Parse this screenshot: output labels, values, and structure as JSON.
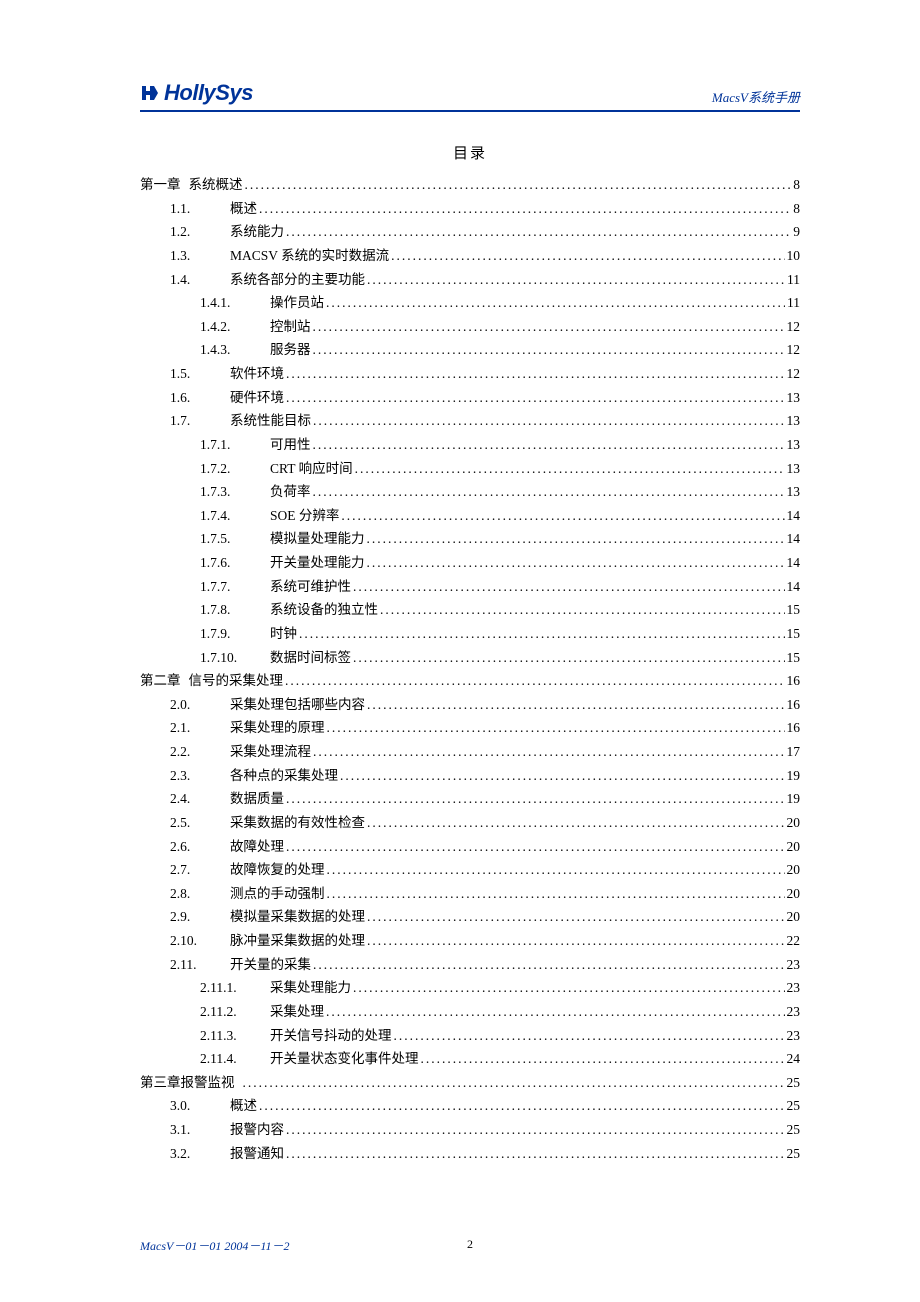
{
  "header": {
    "logo_text": "HollySys",
    "doc_title_prefix": "MacsV",
    "doc_title_suffix": "系统手册"
  },
  "toc_title": "目录",
  "toc": [
    {
      "level": 1,
      "num": "第一章",
      "text": "系统概述",
      "page": "8"
    },
    {
      "level": 2,
      "num": "1.1.",
      "text": "概述",
      "page": "8"
    },
    {
      "level": 2,
      "num": "1.2.",
      "text": "系统能力",
      "page": "9"
    },
    {
      "level": 2,
      "num": "1.3.",
      "text": "MACSV 系统的实时数据流",
      "page": "10"
    },
    {
      "level": 2,
      "num": "1.4.",
      "text": "系统各部分的主要功能",
      "page": "11"
    },
    {
      "level": 3,
      "num": "1.4.1.",
      "text": "操作员站",
      "page": "11"
    },
    {
      "level": 3,
      "num": "1.4.2.",
      "text": "控制站",
      "page": "12"
    },
    {
      "level": 3,
      "num": "1.4.3.",
      "text": "服务器",
      "page": "12"
    },
    {
      "level": 2,
      "num": "1.5.",
      "text": "软件环境",
      "page": "12"
    },
    {
      "level": 2,
      "num": "1.6.",
      "text": "硬件环境",
      "page": "13"
    },
    {
      "level": 2,
      "num": "1.7.",
      "text": "系统性能目标",
      "page": "13"
    },
    {
      "level": 3,
      "num": "1.7.1.",
      "text": "可用性",
      "page": "13"
    },
    {
      "level": 3,
      "num": "1.7.2.",
      "text": "CRT 响应时间",
      "page": "13"
    },
    {
      "level": 3,
      "num": "1.7.3.",
      "text": "负荷率",
      "page": "13"
    },
    {
      "level": 3,
      "num": "1.7.4.",
      "text": "SOE 分辨率",
      "page": "14"
    },
    {
      "level": 3,
      "num": "1.7.5.",
      "text": "模拟量处理能力",
      "page": "14"
    },
    {
      "level": 3,
      "num": "1.7.6.",
      "text": "开关量处理能力",
      "page": "14"
    },
    {
      "level": 3,
      "num": "1.7.7.",
      "text": "系统可维护性",
      "page": "14"
    },
    {
      "level": 3,
      "num": "1.7.8.",
      "text": "系统设备的独立性",
      "page": "15"
    },
    {
      "level": 3,
      "num": "1.7.9.",
      "text": "时钟",
      "page": "15"
    },
    {
      "level": 3,
      "num": "1.7.10.",
      "text": "数据时间标签",
      "page": "15"
    },
    {
      "level": 1,
      "num": "第二章",
      "text": "信号的采集处理",
      "page": "16"
    },
    {
      "level": 2,
      "num": "2.0.",
      "text": "采集处理包括哪些内容",
      "page": "16"
    },
    {
      "level": 2,
      "num": "2.1.",
      "text": "采集处理的原理",
      "page": "16"
    },
    {
      "level": 2,
      "num": "2.2.",
      "text": "采集处理流程",
      "page": "17"
    },
    {
      "level": 2,
      "num": "2.3.",
      "text": "各种点的采集处理",
      "page": "19"
    },
    {
      "level": 2,
      "num": "2.4.",
      "text": "数据质量",
      "page": "19"
    },
    {
      "level": 2,
      "num": "2.5.",
      "text": "采集数据的有效性检查",
      "page": "20"
    },
    {
      "level": 2,
      "num": "2.6.",
      "text": "故障处理",
      "page": "20"
    },
    {
      "level": 2,
      "num": "2.7.",
      "text": "故障恢复的处理",
      "page": "20"
    },
    {
      "level": 2,
      "num": "2.8.",
      "text": "测点的手动强制",
      "page": "20"
    },
    {
      "level": 2,
      "num": "2.9.",
      "text": "模拟量采集数据的处理",
      "page": "20"
    },
    {
      "level": 2,
      "num": "2.10.",
      "text": "脉冲量采集数据的处理",
      "page": "22"
    },
    {
      "level": 2,
      "num": "2.11.",
      "text": "开关量的采集",
      "page": "23"
    },
    {
      "level": 3,
      "num": "2.11.1.",
      "text": "采集处理能力",
      "page": "23"
    },
    {
      "level": 3,
      "num": "2.11.2.",
      "text": "采集处理",
      "page": "23"
    },
    {
      "level": 3,
      "num": "2.11.3.",
      "text": "开关信号抖动的处理",
      "page": "23"
    },
    {
      "level": 3,
      "num": "2.11.4.",
      "text": "开关量状态变化事件处理",
      "page": "24"
    },
    {
      "level": 1,
      "num": "第三章报警监视",
      "text": "",
      "page": "25"
    },
    {
      "level": 2,
      "num": "3.0.",
      "text": "概述",
      "page": "25"
    },
    {
      "level": 2,
      "num": "3.1.",
      "text": "报警内容",
      "page": "25"
    },
    {
      "level": 2,
      "num": "3.2.",
      "text": "报警通知",
      "page": "25"
    }
  ],
  "footer": {
    "left_prefix": "MacsV",
    "left_suffix": "－01－01  2004－11－2",
    "page_num": "2"
  }
}
